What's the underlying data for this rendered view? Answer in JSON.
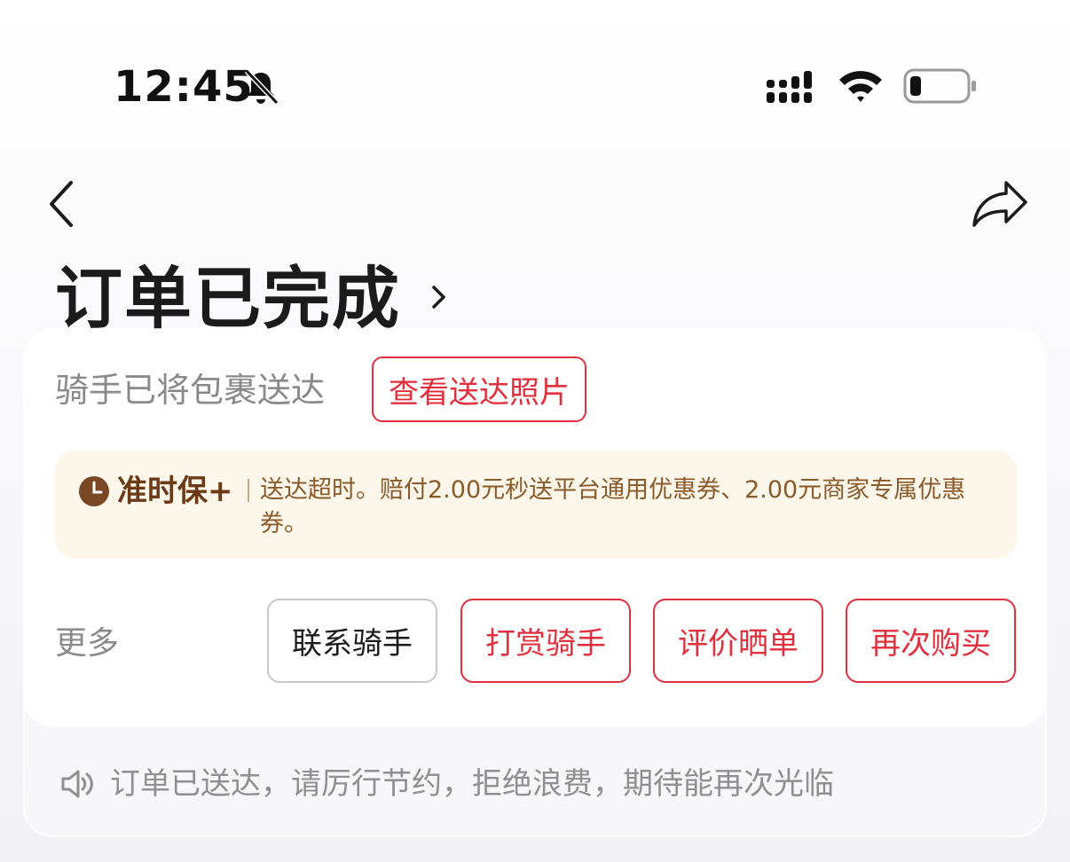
{
  "status_bar": {
    "time": "12:45",
    "icons": [
      "bell-muted-icon",
      "signal-icon",
      "wifi-icon",
      "battery-icon"
    ]
  },
  "nav": {
    "back_icon": "chevron-left-icon",
    "share_icon": "share-icon"
  },
  "order": {
    "title": "订单已完成",
    "subtitle": "骑手已将包裹送达",
    "photo_button": "查看送达照片"
  },
  "notice": {
    "label": "准时保+",
    "text": "送达超时。赔付2.00元秒送平台通用优惠券、2.00元商家专属优惠券。"
  },
  "actions": {
    "more": "更多",
    "buttons": [
      {
        "label": "联系骑手",
        "style": "gray"
      },
      {
        "label": "打赏骑手",
        "style": "red"
      },
      {
        "label": "评价晒单",
        "style": "red"
      },
      {
        "label": "再次购买",
        "style": "red"
      }
    ]
  },
  "footer": {
    "text": "订单已送达，请厉行节约，拒绝浪费，期待能再次光临"
  },
  "colors": {
    "accent_red": "#e0303d",
    "notice_bg": "#fdf6ea",
    "notice_text": "#8a5a2a"
  }
}
